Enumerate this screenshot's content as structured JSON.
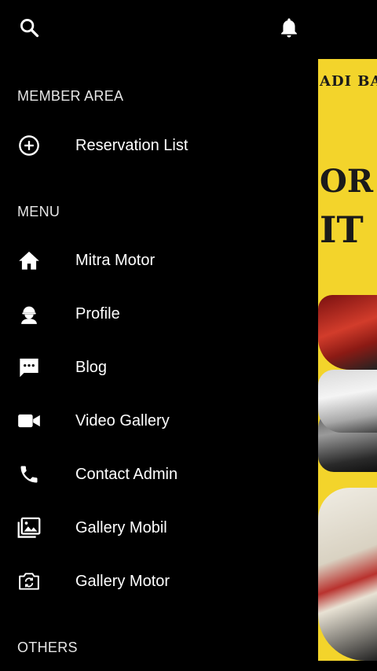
{
  "drawer": {
    "top_icons": [
      "search-icon",
      "bell-icon"
    ],
    "member_area": {
      "header": "MEMBER AREA",
      "items": [
        {
          "label": "Reservation List",
          "icon": "add-circle-icon"
        }
      ]
    },
    "menu": {
      "header": "MENU",
      "items": [
        {
          "label": "Mitra Motor",
          "icon": "home-icon"
        },
        {
          "label": "Profile",
          "icon": "person-icon"
        },
        {
          "label": "Blog",
          "icon": "chat-icon"
        },
        {
          "label": "Video Gallery",
          "icon": "video-camera-icon"
        },
        {
          "label": "Contact Admin",
          "icon": "phone-icon"
        },
        {
          "label": "Gallery Mobil",
          "icon": "photo-gallery-icon"
        },
        {
          "label": "Gallery Motor",
          "icon": "camera-switch-icon"
        }
      ]
    },
    "others": {
      "header": "OTHERS"
    }
  },
  "background": {
    "banner_texts": [
      "ADI BA",
      "OR I",
      "IT"
    ],
    "banner_color": "#f3d42b"
  }
}
